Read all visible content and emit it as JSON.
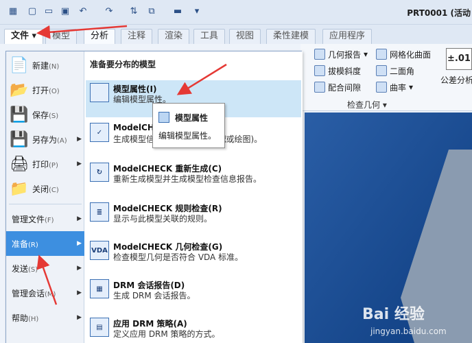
{
  "window": {
    "title": "PRT0001 (活动"
  },
  "tabs": [
    {
      "label": "文件",
      "dropdown": "▾"
    },
    {
      "label": "模型"
    },
    {
      "label": "分析"
    },
    {
      "label": "注释"
    },
    {
      "label": "渲染"
    },
    {
      "label": "工具"
    },
    {
      "label": "视图"
    },
    {
      "label": "柔性建模"
    },
    {
      "label": "应用程序"
    }
  ],
  "ribbon": {
    "items": [
      {
        "label": "几何报告",
        "icon": "geometry-report-icon"
      },
      {
        "label": "网格化曲面",
        "icon": "mesh-surface-icon"
      },
      {
        "label": "拔模斜度",
        "icon": "draft-icon"
      },
      {
        "label": "二面角",
        "icon": "dihedral-angle-icon"
      },
      {
        "label": "配合间隙",
        "icon": "clearance-icon"
      },
      {
        "label": "曲率",
        "icon": "curvature-icon"
      }
    ],
    "group_label": "检查几何",
    "tolerance": {
      "value": "±.01",
      "label": "公差分析"
    }
  },
  "file_menu": {
    "items": [
      {
        "label": "新建",
        "hotkey": "(N)",
        "icon": "new-file-icon",
        "has_arrow": false
      },
      {
        "label": "打开",
        "hotkey": "(O)",
        "icon": "open-folder-icon",
        "has_arrow": false
      },
      {
        "label": "保存",
        "hotkey": "(S)",
        "icon": "save-icon",
        "has_arrow": false
      },
      {
        "label": "另存为",
        "hotkey": "(A)",
        "icon": "save-as-icon",
        "has_arrow": true
      },
      {
        "label": "打印",
        "hotkey": "(P)",
        "icon": "printer-icon",
        "has_arrow": true
      },
      {
        "label": "关闭",
        "hotkey": "(C)",
        "icon": "close-folder-icon",
        "has_arrow": false
      },
      {
        "label": "管理文件",
        "hotkey": "(F)",
        "has_arrow": true
      },
      {
        "label": "准备",
        "hotkey": "(R)",
        "has_arrow": true,
        "selected": true
      },
      {
        "label": "发送",
        "hotkey": "(S)",
        "has_arrow": true
      },
      {
        "label": "管理会话",
        "hotkey": "(M)",
        "has_arrow": true
      },
      {
        "label": "帮助",
        "hotkey": "(H)",
        "has_arrow": true
      }
    ],
    "arrow_glyph": "▶",
    "submenu": {
      "header": "准备要分布的模型",
      "items": [
        {
          "title": "模型属性(I)",
          "desc": "编辑模型属性。",
          "icon_text": "",
          "highlighted": true
        },
        {
          "title": "ModelCHECK",
          "desc": "生成模型信息报告 (零件、装配或绘图)。",
          "icon_text": "✓"
        },
        {
          "title": "ModelCHECK 重新生成(C)",
          "desc": "重新生成模型并生成模型检查信息报告。",
          "icon_text": "↻"
        },
        {
          "title": "ModelCHECK 规则检查(R)",
          "desc": "显示与此模型关联的规则。",
          "icon_text": "≣"
        },
        {
          "title": "ModelCHECK 几何检查(G)",
          "desc": "检查模型几何是否符合 VDA 标准。",
          "icon_text": "VDA"
        },
        {
          "title": "DRM 会话报告(D)",
          "desc": "生成 DRM 会话报告。",
          "icon_text": "▦"
        },
        {
          "title": "应用 DRM 策略(A)",
          "desc": "定义应用 DRM 策略的方式。",
          "icon_text": "▤"
        }
      ]
    }
  },
  "tooltip": {
    "title": "模型属性",
    "desc": "编辑模型属性。"
  },
  "watermark": {
    "text": "Bai 经验",
    "url": "jingyan.baidu.com"
  },
  "colors": {
    "selection": "#3d8fe0",
    "highlight": "#cde6f7",
    "viewport": "#13478d",
    "arrow": "#e53935"
  }
}
